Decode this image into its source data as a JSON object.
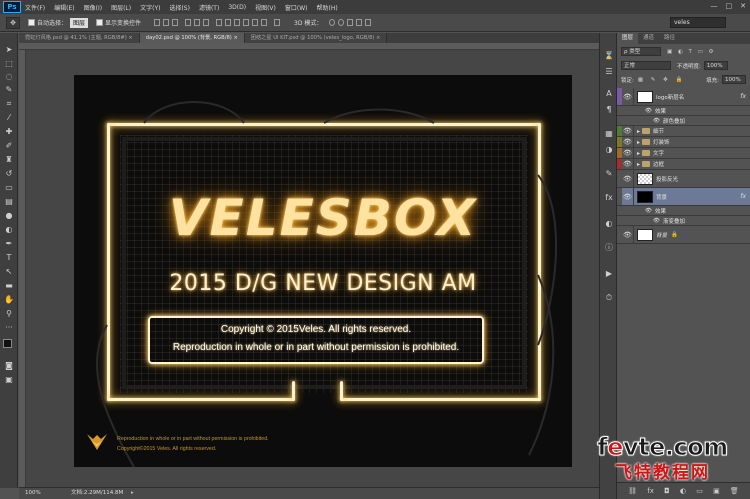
{
  "app": {
    "logo": "Ps",
    "menu": [
      "文件(F)",
      "编辑(E)",
      "图像(I)",
      "图层(L)",
      "文字(Y)",
      "选择(S)",
      "滤镜(T)",
      "3D(D)",
      "视图(V)",
      "窗口(W)",
      "帮助(H)"
    ],
    "window_controls": [
      "—",
      "□",
      "✕"
    ]
  },
  "options": {
    "auto_select_label": "自动选择：",
    "auto_select_value": "图层",
    "show_transform_label": "显示变换控件",
    "mode_3d_label": "3D 模式：",
    "workspace_value": "veles"
  },
  "tabs": [
    {
      "label": "霓虹灯风格.psd @ 41.1% (主题, RGB/8#) ×",
      "active": false
    },
    {
      "label": "day02.psd @ 100% (背景, RGB/8) ×",
      "active": true
    },
    {
      "label": "团结之星 UI KIT.psd @ 100% (veles_logo, RGB/8) ×",
      "active": false
    }
  ],
  "artwork": {
    "title": "VELESBOX",
    "subtitle": "2015 D/G   NEW DESIGN AM",
    "copyright_line1": "Copyright © 2015Veles. All rights reserved.",
    "copyright_line2": "Reproduction in whole or in part without permission is prohibited.",
    "footer_line1": "Reproduction in whole or in part without permission is prohibited.",
    "footer_line2": "Copyright©2015 Veles. All rights reserved."
  },
  "status": {
    "zoom": "100%",
    "doc_info": "文档:2.29M/114.8M"
  },
  "panel": {
    "tabs": [
      "图层",
      "通道",
      "路径"
    ],
    "kind_label": "ρ 类型",
    "blend_mode": "正常",
    "opacity_label": "不透明度:",
    "opacity_value": "100%",
    "lock_label": "锁定:",
    "fill_label": "填充:",
    "fill_value": "100%",
    "layers": [
      {
        "name": "logo新层名",
        "type": "text",
        "color": "#7a5aa0",
        "fx": true
      },
      {
        "name": "效果",
        "type": "effect"
      },
      {
        "name": "颜色叠加",
        "type": "effect-item"
      },
      {
        "name": "細节",
        "type": "folder",
        "color": "#4f7a3a"
      },
      {
        "name": "灯装饰",
        "type": "folder",
        "color": "#7a7a2a"
      },
      {
        "name": "文字",
        "type": "folder",
        "color": "#a06a2a"
      },
      {
        "name": "边框",
        "type": "folder",
        "color": "#a03030"
      },
      {
        "name": "投影反光",
        "type": "layer",
        "color": "#535353"
      },
      {
        "name": "背景",
        "type": "layer",
        "color": "#535353",
        "fx": true,
        "selected": true
      },
      {
        "name": "效果",
        "type": "effect"
      },
      {
        "name": "渐变叠加",
        "type": "effect-item"
      },
      {
        "name": "背景",
        "type": "locked",
        "color": "#535353"
      }
    ]
  },
  "watermark": {
    "line1_a": "f",
    "line1_e": "e",
    "line1_b": "vte.com",
    "line2": "飞特教程网"
  }
}
